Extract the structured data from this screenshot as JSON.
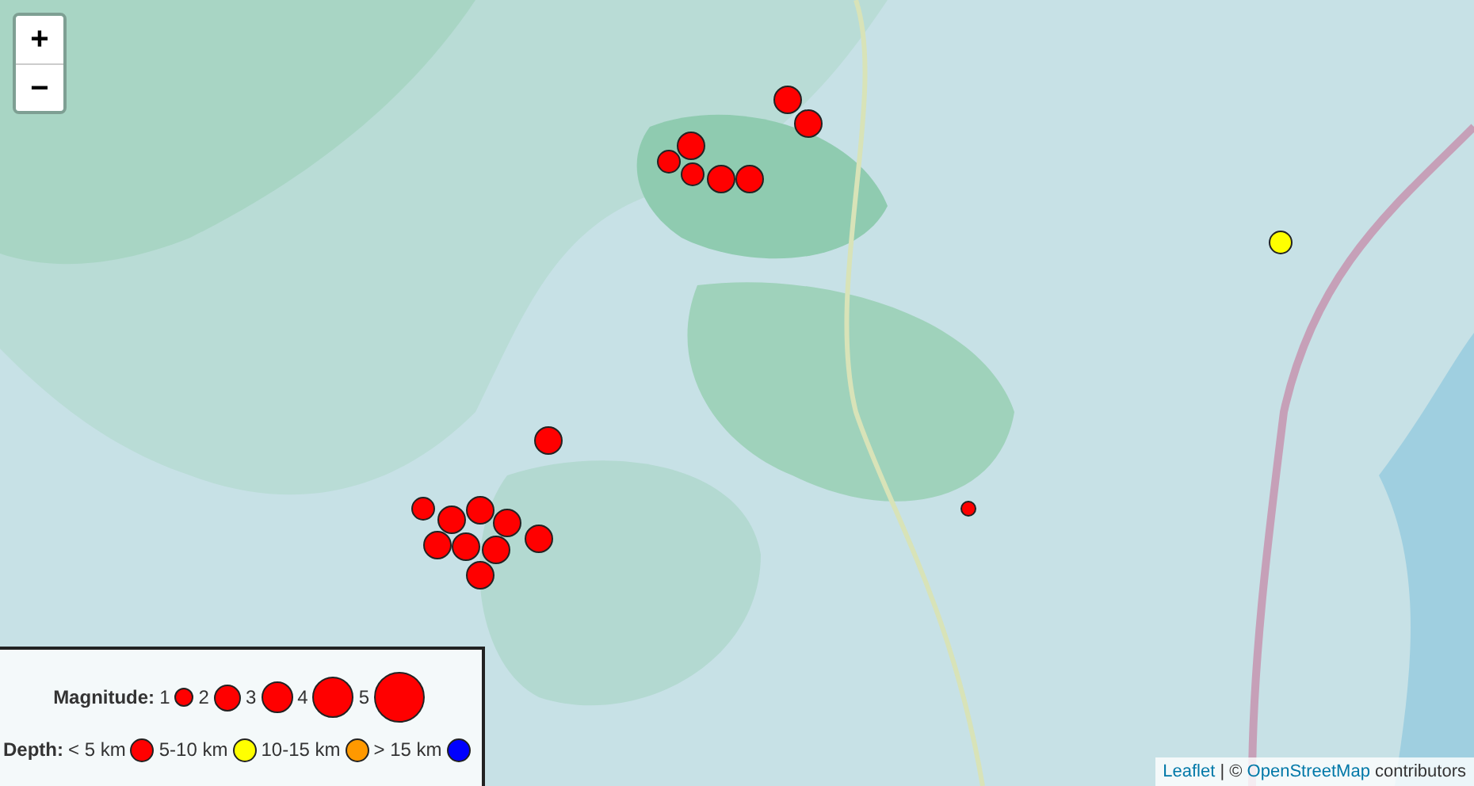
{
  "map": {
    "zoom_controls": [
      {
        "label": "+"
      },
      {
        "label": "−"
      }
    ],
    "events": [
      {
        "kind": "m3",
        "color": "#ff0000"
      },
      {
        "kind": "m3",
        "color": "#ff0000"
      },
      {
        "kind": "m3",
        "color": "#ff0000"
      },
      {
        "kind": "m2",
        "color": "#ff0000"
      },
      {
        "kind": "m2",
        "color": "#ff0000"
      },
      {
        "kind": "m3",
        "color": "#ff0000"
      },
      {
        "kind": "m3",
        "color": "#ff0000"
      },
      {
        "kind": "m2",
        "color": "#ffff00"
      },
      {
        "kind": "m3",
        "color": "#ff0000"
      },
      {
        "kind": "m2",
        "color": "#ff0000"
      },
      {
        "kind": "m3",
        "color": "#ff0000"
      },
      {
        "kind": "m3",
        "color": "#ff0000"
      },
      {
        "kind": "m3",
        "color": "#ff0000"
      },
      {
        "kind": "m3",
        "color": "#ff0000"
      },
      {
        "kind": "m3",
        "color": "#ff0000"
      },
      {
        "kind": "m3",
        "color": "#ff0000"
      },
      {
        "kind": "m3",
        "color": "#ff0000"
      },
      {
        "kind": "m3",
        "color": "#ff0000"
      },
      {
        "kind": "m1",
        "color": "#ff0000"
      }
    ]
  },
  "legend": {
    "magnitude": {
      "title": "Magnitude:",
      "items": [
        {
          "label": "1",
          "kind": "m1"
        },
        {
          "label": "2",
          "kind": "m2"
        },
        {
          "label": "3",
          "kind": "m3"
        },
        {
          "label": "4",
          "kind": "m4"
        },
        {
          "label": "5",
          "kind": "m5"
        }
      ]
    },
    "depth": {
      "title": "Depth:",
      "items": [
        {
          "label": "< 5 km",
          "color": "#ff0000"
        },
        {
          "label": "5-10 km",
          "color": "#ffff00"
        },
        {
          "label": "10-15 km",
          "color": "#ff9900"
        },
        {
          "label": "> 15 km",
          "color": "#0000ff"
        }
      ]
    }
  },
  "attribution": [
    {
      "kind": "link",
      "text": "Leaflet"
    },
    {
      "kind": "text",
      "text": "| ©"
    },
    {
      "kind": "link",
      "text": "OpenStreetMap"
    },
    {
      "kind": "text",
      "text": "contributors"
    }
  ]
}
